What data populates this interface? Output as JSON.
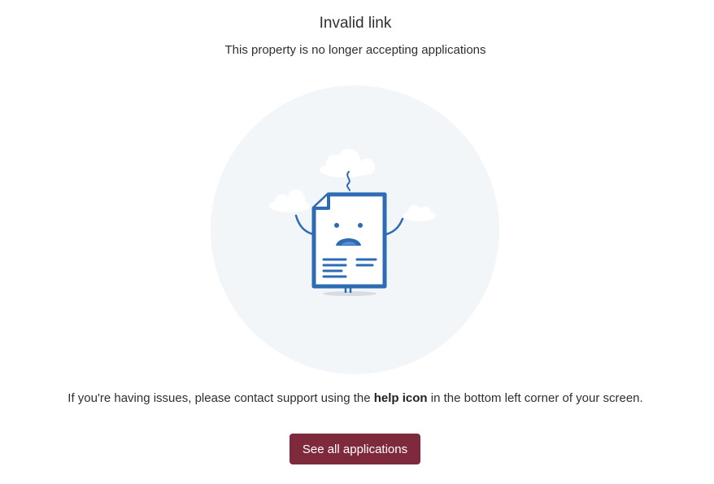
{
  "header": {
    "title": "Invalid link",
    "subtitle": "This property is no longer accepting applications"
  },
  "illustration": {
    "icon": "sad-document-icon",
    "circle_color": "#f3f6f9",
    "stroke_color": "#2d6bb5",
    "cloud_color": "#ffffff"
  },
  "help": {
    "prefix": "If you're having issues, please contact support using the ",
    "emphasis": "help icon",
    "suffix": " in the bottom left corner of your screen."
  },
  "actions": {
    "see_all_label": "See all applications",
    "button_color": "#7f2a3c"
  }
}
